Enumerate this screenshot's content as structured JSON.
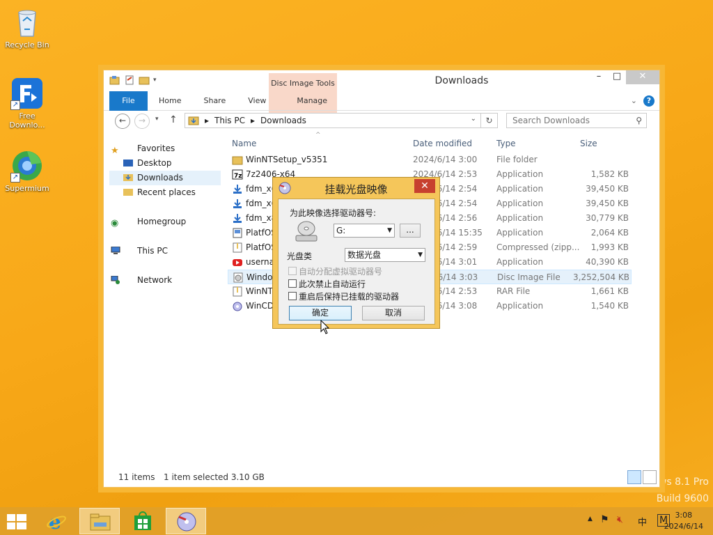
{
  "desktop": {
    "icons": [
      {
        "label": "Recycle Bin"
      },
      {
        "label": "Free\nDownlo..."
      },
      {
        "label": "Supermium"
      }
    ],
    "watermark_line1": "ws 8.1 Pro",
    "watermark_line2": "Build 9600"
  },
  "explorer": {
    "title": "Downloads",
    "context_tab_group": "Disc Image Tools",
    "ribbon_tabs": [
      "File",
      "Home",
      "Share",
      "View",
      "Manage"
    ],
    "address": {
      "parts": [
        "This PC",
        "Downloads"
      ]
    },
    "search_placeholder": "Search Downloads",
    "nav": {
      "favorites": "Favorites",
      "desktop": "Desktop",
      "downloads": "Downloads",
      "recent": "Recent places",
      "homegroup": "Homegroup",
      "thispc": "This PC",
      "network": "Network"
    },
    "columns": {
      "name": "Name",
      "date": "Date modified",
      "type": "Type",
      "size": "Size"
    },
    "files": [
      {
        "name": "WinNTSetup_v5351",
        "date": "2024/6/14 3:00",
        "type": "File folder",
        "size": ""
      },
      {
        "name": "7z2406-x64",
        "date": "2024/6/14 2:53",
        "type": "Application",
        "size": "1,582 KB"
      },
      {
        "name": "fdm_x6",
        "date": "2024/6/14 2:54",
        "type": "Application",
        "size": "39,450 KB"
      },
      {
        "name": "fdm_x6",
        "date": "2024/6/14 2:54",
        "type": "Application",
        "size": "39,450 KB"
      },
      {
        "name": "fdm_x8",
        "date": "2024/6/14 2:56",
        "type": "Application",
        "size": "30,779 KB"
      },
      {
        "name": "PlatfOS",
        "date": "2024/6/14 15:35",
        "type": "Application",
        "size": "2,064 KB"
      },
      {
        "name": "PlatfOS",
        "date": "2024/6/14 2:59",
        "type": "Compressed (zipp...",
        "size": "1,993 KB"
      },
      {
        "name": "usernar",
        "date": "2024/6/14 3:01",
        "type": "Application",
        "size": "40,390 KB"
      },
      {
        "name": "Window",
        "date": "2024/6/14 3:03",
        "type": "Disc Image File",
        "size": "3,252,504 KB"
      },
      {
        "name": "WinNT",
        "date": "2024/6/14 2:53",
        "type": "RAR File",
        "size": "1,661 KB"
      },
      {
        "name": "WinCD",
        "date": "2024/6/14 3:08",
        "type": "Application",
        "size": "1,540 KB"
      }
    ],
    "status": {
      "items": "11 items",
      "selected": "1 item selected  3.10 GB"
    }
  },
  "dialog": {
    "title": "挂载光盘映像",
    "drive_label": "为此映像选择驱动器号:",
    "drive_value": "G:",
    "browse_label": "...",
    "type_label": "光盘类",
    "type_value": "数据光盘",
    "auto_assign": "自动分配虚拟驱动器号",
    "disable_autorun": "此次禁止自动运行",
    "keep_after_reboot": "重启后保持已挂载的驱动器",
    "ok": "确定",
    "cancel": "取消"
  },
  "taskbar": {
    "time": "3:08",
    "date": "2024/6/14",
    "ime": "中",
    "ime2": "M"
  }
}
